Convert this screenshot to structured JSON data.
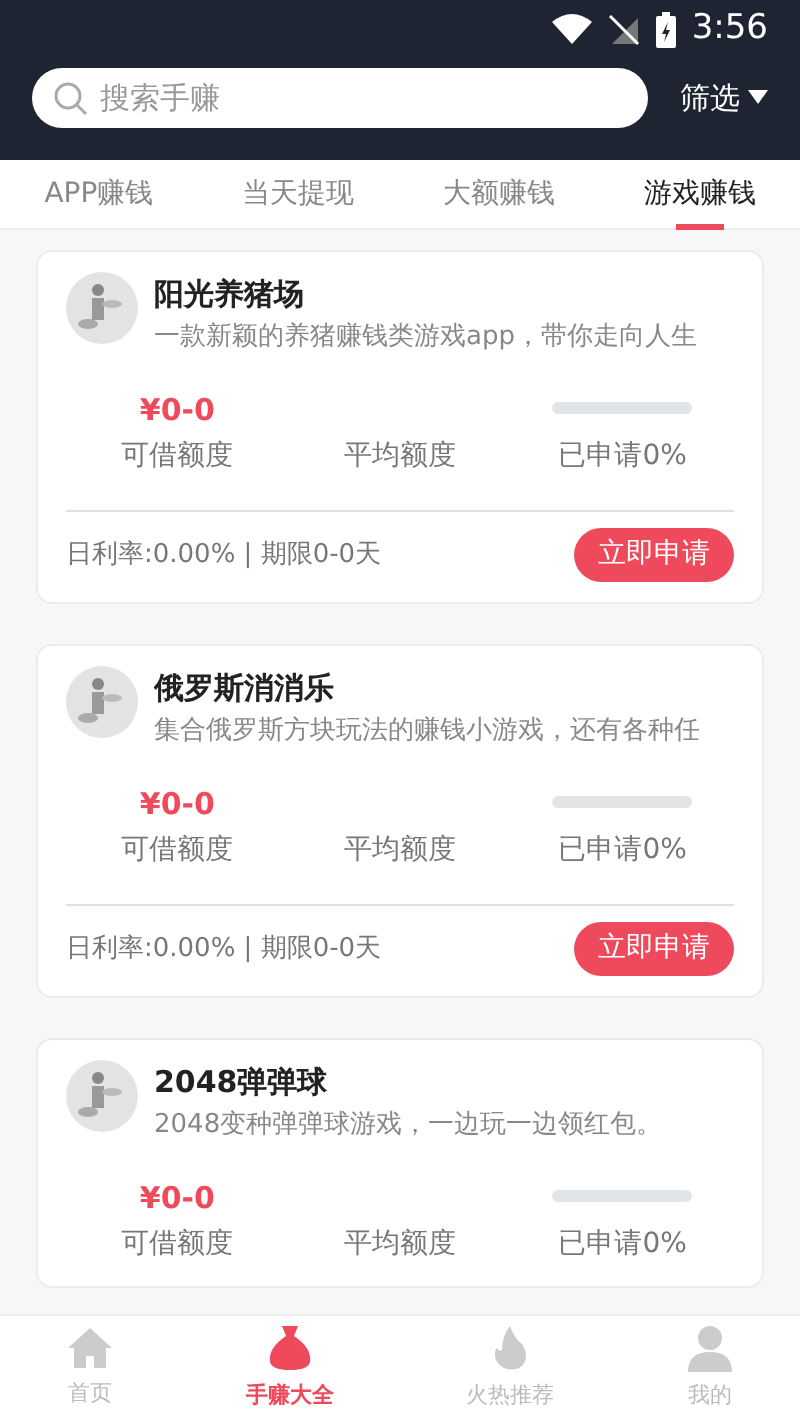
{
  "status_bar": {
    "time": "3:56"
  },
  "search": {
    "placeholder": "搜索手赚"
  },
  "filter": {
    "label": "筛选"
  },
  "tabs": [
    {
      "label": "APP赚钱",
      "selected": false
    },
    {
      "label": "当天提现",
      "selected": false
    },
    {
      "label": "大额赚钱",
      "selected": false
    },
    {
      "label": "游戏赚钱",
      "selected": true
    }
  ],
  "cards": [
    {
      "title": "阳光养猪场",
      "description": "一款新颖的养猪赚钱类游戏app，带你走向人生",
      "amount": "¥0-0",
      "stats": [
        "可借额度",
        "平均额度",
        "已申请0%"
      ],
      "level": 0,
      "terms": "日利率:0.00% | 期限0-0天",
      "button": "立即申请"
    },
    {
      "title": "俄罗斯消消乐",
      "description": "集合俄罗斯方块玩法的赚钱小游戏，还有各种任",
      "amount": "¥0-0",
      "stats": [
        "可借额度",
        "平均额度",
        "已申请0%"
      ],
      "level": 0,
      "terms": "日利率:0.00% | 期限0-0天",
      "button": "立即申请"
    },
    {
      "title": "2048弹弹球",
      "description": "2048变种弹弹球游戏，一边玩一边领红包。",
      "amount": "¥0-0",
      "stats": [
        "可借额度",
        "平均额度",
        "已申请0%"
      ],
      "level": 0
    }
  ],
  "bottom_nav": [
    {
      "label": "首页",
      "kind": "home",
      "selected": false
    },
    {
      "label": "手赚大全",
      "kind": "bag",
      "selected": true
    },
    {
      "label": "火热推荐",
      "kind": "flame",
      "selected": false
    },
    {
      "label": "我的",
      "kind": "person",
      "selected": false
    }
  ]
}
